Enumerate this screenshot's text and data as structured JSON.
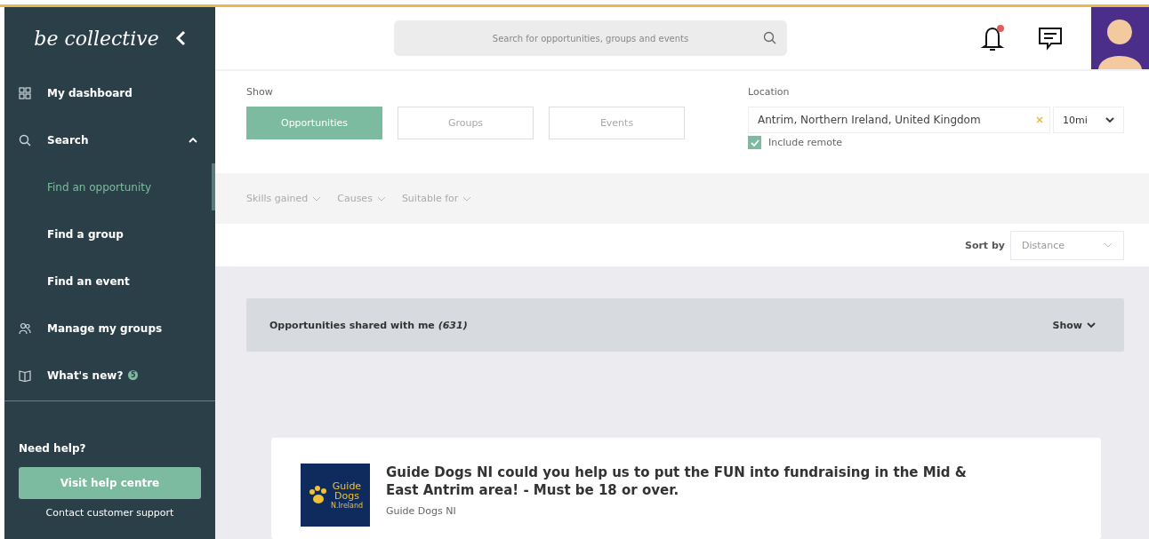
{
  "sidebar": {
    "logo": "be collective",
    "items": [
      {
        "label": "My dashboard",
        "selected": false
      },
      {
        "label": "Search",
        "selected": false,
        "expanded": true,
        "children": [
          {
            "label": "Find an opportunity",
            "selected": true
          },
          {
            "label": "Find a group",
            "selected": false
          },
          {
            "label": "Find an event",
            "selected": false
          }
        ]
      },
      {
        "label": "Manage my groups",
        "selected": false
      },
      {
        "label": "What's new?",
        "selected": false,
        "badge": "5"
      }
    ],
    "help": {
      "title": "Need help?",
      "button": "Visit help centre",
      "link": "Contact customer support"
    }
  },
  "header": {
    "search": {
      "placeholder": "Search for opportunities, groups and events"
    },
    "notifications": {
      "unread": true
    }
  },
  "filters": {
    "show_label": "Show",
    "tabs": [
      {
        "label": "Opportunities",
        "selected": true
      },
      {
        "label": "Groups",
        "selected": false
      },
      {
        "label": "Events",
        "selected": false
      }
    ],
    "location": {
      "label": "Location",
      "value": "Antrim, Northern Ireland, United Kingdom",
      "radius": "10mi",
      "include_remote": {
        "label": "Include remote",
        "checked": true
      }
    },
    "dropdowns": [
      "Skills gained",
      "Causes",
      "Suitable for"
    ],
    "sort": {
      "label": "Sort by",
      "value": "Distance"
    }
  },
  "shared": {
    "title": "Opportunities shared with me *(631)*",
    "toggle": "Show"
  },
  "results": [
    {
      "title": "Guide Dogs NI could you help us to put the FUN into fundraising in the Mid & East Antrim area! - Must be 18 or over.",
      "organisation": "Guide Dogs NI",
      "logo_lines": [
        "Guide",
        "Dogs",
        "N.Ireland"
      ]
    }
  ]
}
